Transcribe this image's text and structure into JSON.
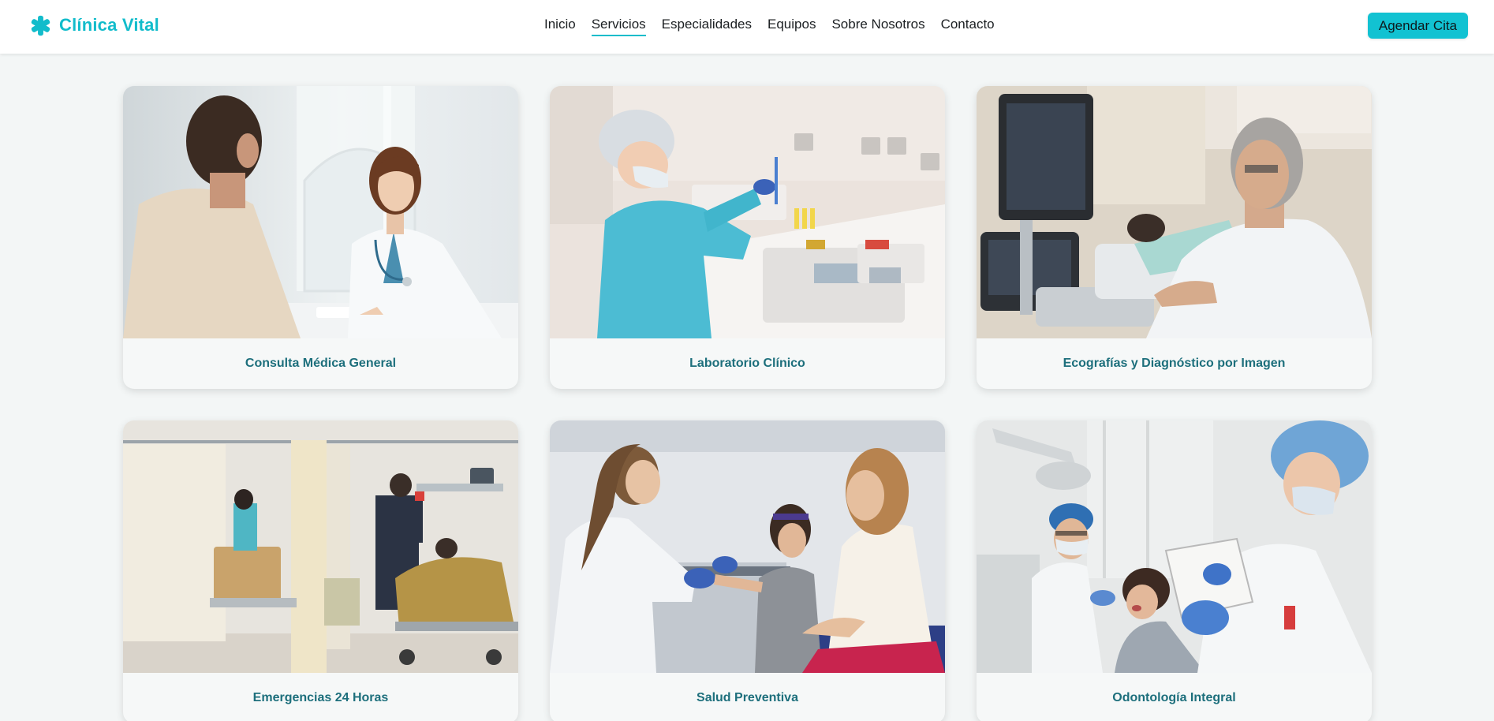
{
  "brand": {
    "name": "Clínica Vital",
    "icon": "medical-cross-icon",
    "color": "#12bccb"
  },
  "nav": {
    "items": [
      {
        "label": "Inicio",
        "active": false
      },
      {
        "label": "Servicios",
        "active": true
      },
      {
        "label": "Especialidades",
        "active": false
      },
      {
        "label": "Equipos",
        "active": false
      },
      {
        "label": "Sobre Nosotros",
        "active": false
      },
      {
        "label": "Contacto",
        "active": false
      }
    ]
  },
  "cta": {
    "label": "Agendar Cita",
    "color": "#12c2d2"
  },
  "services": [
    {
      "title": "Consulta Médica General",
      "image": "doctor-consultation-photo"
    },
    {
      "title": "Laboratorio Clínico",
      "image": "lab-technician-photo"
    },
    {
      "title": "Ecografías y Diagnóstico por Imagen",
      "image": "ultrasound-exam-photo"
    },
    {
      "title": "Emergencias 24 Horas",
      "image": "emergency-ward-photo"
    },
    {
      "title": "Salud Preventiva",
      "image": "child-checkup-photo"
    },
    {
      "title": "Odontología Integral",
      "image": "dental-care-photo"
    }
  ],
  "colors": {
    "accent": "#12bccb",
    "card_title": "#1d6f7c",
    "page_background": "#f3f6f6"
  }
}
